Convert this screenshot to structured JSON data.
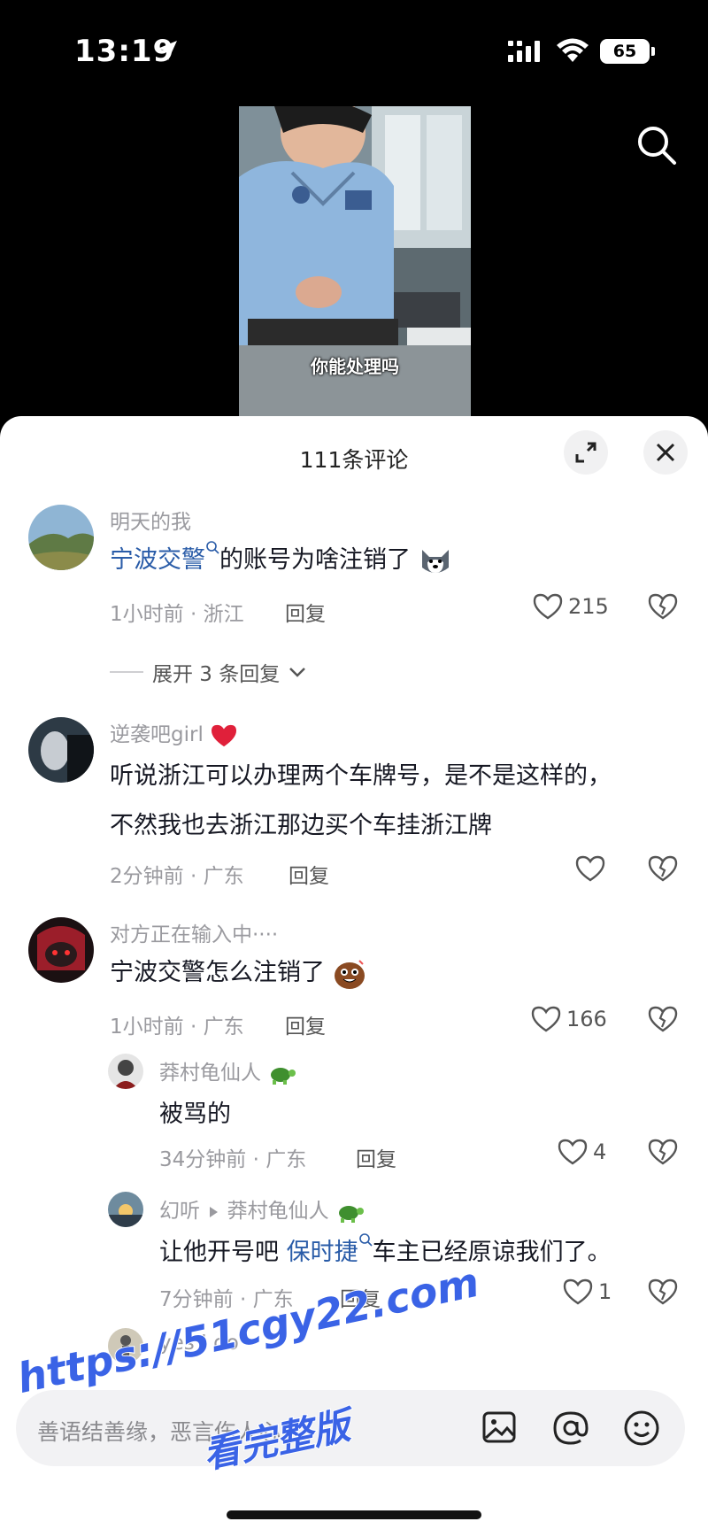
{
  "status_bar": {
    "time": "13:19",
    "battery": "65"
  },
  "video": {
    "caption": "你能处理吗"
  },
  "sheet": {
    "title": "111条评论"
  },
  "comments": [
    {
      "username": "明天的我",
      "text_link": "宁波交警",
      "text_rest": "的账号为啥注销了",
      "meta": "1小时前 · 浙江",
      "reply": "回复",
      "likes": "215"
    },
    {
      "username": "逆袭吧girl",
      "text_line1": "听说浙江可以办理两个车牌号，是不是这样的，",
      "text_line2": "不然我也去浙江那边买个车挂浙江牌",
      "meta": "2分钟前 · 广东",
      "reply": "回复"
    },
    {
      "username": "对方正在输入中····",
      "text": "宁波交警怎么注销了",
      "meta": "1小时前 · 广东",
      "reply": "回复",
      "likes": "166"
    }
  ],
  "expand_replies": "展开 3 条回复",
  "replies": [
    {
      "username": "莽村龟仙人",
      "text": "被骂的",
      "meta": "34分钟前 · 广东",
      "reply": "回复",
      "likes": "4"
    },
    {
      "username": "幻听",
      "reply_to": "莽村龟仙人",
      "text_pre": "让他开号吧 ",
      "text_link": "保时捷",
      "text_post": "车主已经原谅我们了。",
      "meta": "7分钟前 · 广东",
      "reply": "回复",
      "likes": "1"
    },
    {
      "username": "yes I do"
    }
  ],
  "input": {
    "placeholder": "善语结善缘，恶言伤人心"
  },
  "watermark": {
    "line1": "https://51cgy22.com",
    "line2": "看完整版"
  },
  "colors": {
    "link": "#2a5ca8",
    "heart": "#e0203a",
    "watermark": "#3a63e6"
  },
  "icons": [
    "location-arrow-icon",
    "signal-icon",
    "wifi-icon",
    "search-icon",
    "expand-icon",
    "close-icon",
    "heart-icon",
    "dislike-icon",
    "chevron-down-icon",
    "image-icon",
    "at-icon",
    "emoji-icon"
  ]
}
